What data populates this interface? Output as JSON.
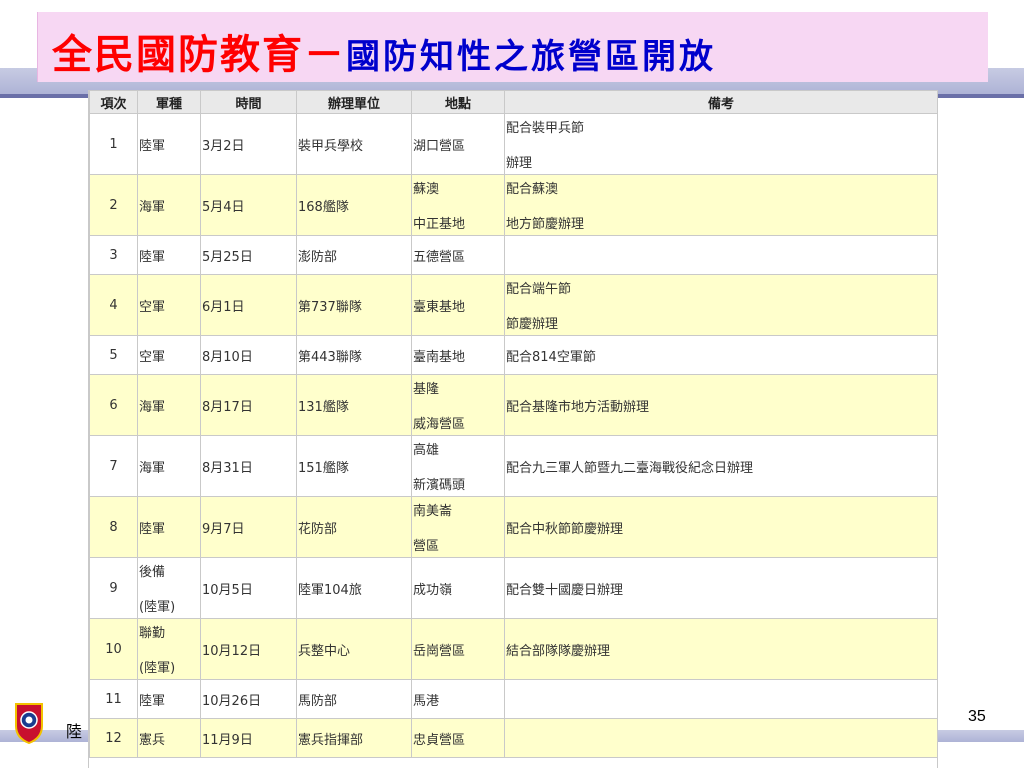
{
  "title": {
    "part1": "全民國防教育－",
    "part2": "國防知性之旅營區開放"
  },
  "table": {
    "headers": [
      "項次",
      "軍種",
      "時間",
      "辦理單位",
      "地點",
      "備考"
    ],
    "rows": [
      {
        "no": "1",
        "branch": [
          "陸軍"
        ],
        "date": "3月2日",
        "unit": "裝甲兵學校",
        "place": [
          "湖口營區"
        ],
        "note": [
          "配合裝甲兵節",
          "辦理"
        ]
      },
      {
        "no": "2",
        "branch": [
          "海軍"
        ],
        "date": "5月4日",
        "unit": "168艦隊",
        "place": [
          "蘇澳",
          "中正基地"
        ],
        "note": [
          "配合蘇澳",
          "地方節慶辦理"
        ]
      },
      {
        "no": "3",
        "branch": [
          "陸軍"
        ],
        "date": "5月25日",
        "unit": "澎防部",
        "place": [
          "五德營區"
        ],
        "note": []
      },
      {
        "no": "4",
        "branch": [
          "空軍"
        ],
        "date": "6月1日",
        "unit": "第737聯隊",
        "place": [
          "臺東基地"
        ],
        "note": [
          "配合端午節",
          "節慶辦理"
        ]
      },
      {
        "no": "5",
        "branch": [
          "空軍"
        ],
        "date": "8月10日",
        "unit": "第443聯隊",
        "place": [
          "臺南基地"
        ],
        "note": [
          "配合814空軍節"
        ]
      },
      {
        "no": "6",
        "branch": [
          "海軍"
        ],
        "date": "8月17日",
        "unit": "131艦隊",
        "place": [
          "基隆",
          "威海營區"
        ],
        "note": [
          "配合基隆市地方活動辦理"
        ]
      },
      {
        "no": "7",
        "branch": [
          "海軍"
        ],
        "date": "8月31日",
        "unit": "151艦隊",
        "place": [
          "高雄",
          "新濱碼頭"
        ],
        "note": [
          "配合九三軍人節暨九二臺海戰役紀念日辦理"
        ]
      },
      {
        "no": "8",
        "branch": [
          "陸軍"
        ],
        "date": "9月7日",
        "unit": "花防部",
        "place": [
          "南美崙",
          "營區"
        ],
        "note": [
          "配合中秋節節慶辦理"
        ]
      },
      {
        "no": "9",
        "branch": [
          "後備",
          "(陸軍)"
        ],
        "date": "10月5日",
        "unit": "陸軍104旅",
        "place": [
          "成功嶺"
        ],
        "note": [
          "配合雙十國慶日辦理"
        ]
      },
      {
        "no": "10",
        "branch": [
          "聯勤",
          "(陸軍)"
        ],
        "date": "10月12日",
        "unit": "兵整中心",
        "place": [
          "岳崗營區"
        ],
        "note": [
          "結合部隊隊慶辦理"
        ]
      },
      {
        "no": "11",
        "branch": [
          "陸軍"
        ],
        "date": "10月26日",
        "unit": "馬防部",
        "place": [
          "馬港"
        ],
        "note": []
      },
      {
        "no": "12",
        "branch": [
          "憲兵"
        ],
        "date": "11月9日",
        "unit": "憲兵指揮部",
        "place": [
          "忠貞營區"
        ],
        "note": []
      }
    ]
  },
  "footer": {
    "text": "陸",
    "page": "35"
  },
  "colors": {
    "title_red": "#ff0000",
    "title_blue": "#0000cc",
    "title_bg": "#f7d7f3",
    "row_alt": "#ffffcc"
  }
}
